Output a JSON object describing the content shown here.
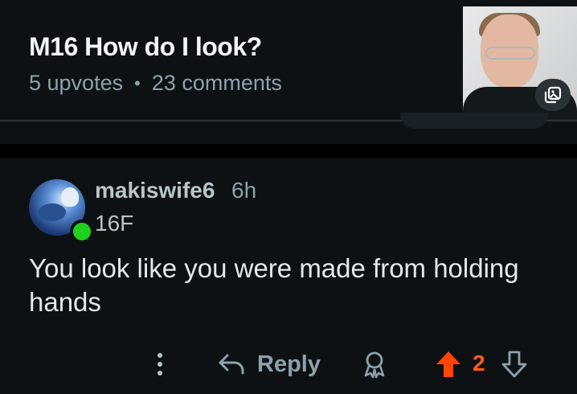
{
  "post": {
    "title": "M16 How do I look?",
    "upvotes": "5 upvotes",
    "separator": "•",
    "comments": "23 comments",
    "thumbnail_icon": "gallery-icon"
  },
  "comment": {
    "username": "makiswife6",
    "time": "6h",
    "flair": "16F",
    "body": "You look like you were made from holding hands",
    "online": true,
    "actions": {
      "more_icon": "more-vertical-icon",
      "reply_icon": "reply-arrow-icon",
      "reply_label": "Reply",
      "award_icon": "award-icon",
      "upvote_icon": "upvote-arrow-icon",
      "score": "2",
      "downvote_icon": "downvote-arrow-icon"
    }
  },
  "colors": {
    "background": "#0e1113",
    "upvote_active": "#ff4500",
    "online": "#1fd11f",
    "muted_text": "#8ba2ad"
  }
}
